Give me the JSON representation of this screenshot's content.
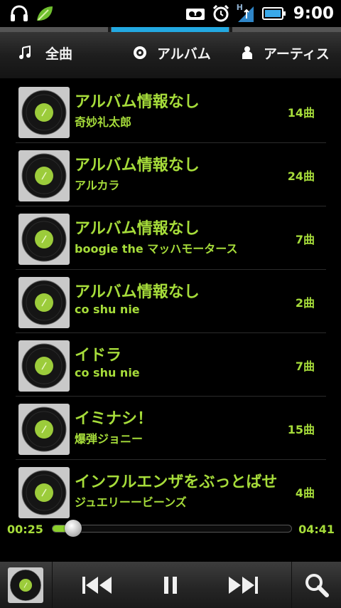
{
  "status_bar": {
    "time": "9:00",
    "network": "H"
  },
  "tabs": [
    {
      "label": "全曲",
      "icon": "music-note-icon"
    },
    {
      "label": "アルバム",
      "icon": "album-disc-icon"
    },
    {
      "label": "アーティス",
      "icon": "person-icon"
    }
  ],
  "albums": [
    {
      "title": "アルバム情報なし",
      "artist": "奇妙礼太郎",
      "count": "14曲"
    },
    {
      "title": "アルバム情報なし",
      "artist": "アルカラ",
      "count": "24曲"
    },
    {
      "title": "アルバム情報なし",
      "artist": "boogie the マッハモータース",
      "count": "7曲"
    },
    {
      "title": "アルバム情報なし",
      "artist": "co shu nie",
      "count": "2曲"
    },
    {
      "title": "イドラ",
      "artist": "co shu nie",
      "count": "7曲"
    },
    {
      "title": "イミナシ！",
      "artist": "爆弾ジョニー",
      "count": "15曲"
    },
    {
      "title": "インフルエンザをぶっとばせ",
      "artist": "ジュエリーービーンズ",
      "count": "4曲"
    }
  ],
  "player": {
    "elapsed": "00:25",
    "total": "04:41",
    "progress_fraction": 0.09
  },
  "colors": {
    "accent_green": "#a6dc3a",
    "tab_indicator": "#23a9e1"
  }
}
